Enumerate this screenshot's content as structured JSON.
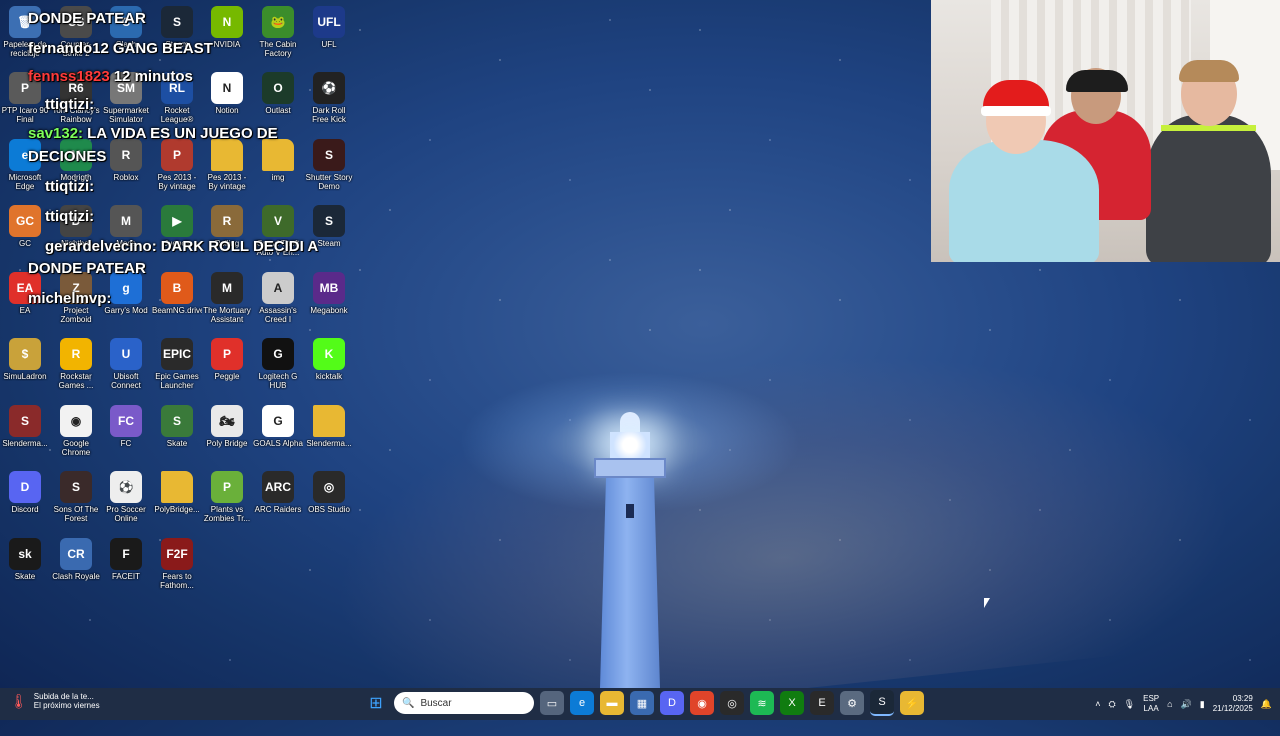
{
  "desktop": {
    "icons": [
      {
        "label": "Papelera de reciclaje",
        "color": "#3c6fb3",
        "glyph": "🗑",
        "icon": "recycle-bin"
      },
      {
        "label": "Counter-Strike 2",
        "color": "#4a4a4a",
        "glyph": "CS",
        "icon": "counter-strike"
      },
      {
        "label": "Clash",
        "color": "#2b6ab0",
        "glyph": "C",
        "icon": "game"
      },
      {
        "label": "Steam",
        "color": "#1b2838",
        "glyph": "S",
        "icon": "steam"
      },
      {
        "label": "NVIDIA",
        "color": "#76b900",
        "glyph": "N",
        "icon": "nvidia"
      },
      {
        "label": "The Cabin Factory",
        "color": "#3b8d2b",
        "glyph": "🐸",
        "icon": "frog"
      },
      {
        "label": "UFL",
        "color": "#1d3a8a",
        "glyph": "UFL",
        "icon": "ufl"
      },
      {
        "label": "PTP Icaro 90 Final",
        "color": "#5a5a5a",
        "glyph": "P",
        "icon": "app"
      },
      {
        "label": "Tom Clancy's Rainbow Six...",
        "color": "#333333",
        "glyph": "R6",
        "icon": "game"
      },
      {
        "label": "Supermarket Simulator",
        "color": "#777777",
        "glyph": "SM",
        "icon": "game"
      },
      {
        "label": "Rocket League®",
        "color": "#1d4fa3",
        "glyph": "RL",
        "icon": "rocket"
      },
      {
        "label": "Notion",
        "color": "#ffffff",
        "glyph": "N",
        "icon": "notion"
      },
      {
        "label": "Outlast",
        "color": "#1c3b2a",
        "glyph": "O",
        "icon": "game"
      },
      {
        "label": "Dark Roll Free Kick Challe...",
        "color": "#222222",
        "glyph": "⚽",
        "icon": "ball"
      },
      {
        "label": "Microsoft Edge",
        "color": "#0c7bd6",
        "glyph": "e",
        "icon": "edge"
      },
      {
        "label": "Modrigth",
        "color": "#1f8a4c",
        "glyph": "M",
        "icon": "app"
      },
      {
        "label": "Roblox",
        "color": "#555555",
        "glyph": "R",
        "icon": "roblox"
      },
      {
        "label": "Pes 2013 - By vintage Ga...",
        "color": "#b03a2e",
        "glyph": "P",
        "icon": "winrar"
      },
      {
        "label": "Pes 2013 - By vintage Ga...",
        "color": "#e8b833",
        "glyph": "",
        "icon": "folder"
      },
      {
        "label": "img",
        "color": "#e8b833",
        "glyph": "",
        "icon": "folder"
      },
      {
        "label": "Shutter Story Demo",
        "color": "#3a1a1a",
        "glyph": "S",
        "icon": "game"
      },
      {
        "label": "GC",
        "color": "#e0742c",
        "glyph": "GC",
        "icon": "app"
      },
      {
        "label": "Nightbot",
        "color": "#444444",
        "glyph": "D",
        "icon": "app"
      },
      {
        "label": "Mods",
        "color": "#555555",
        "glyph": "M",
        "icon": "app"
      },
      {
        "label": "Juegos",
        "color": "#2a7a3b",
        "glyph": "▶",
        "icon": "game"
      },
      {
        "label": "Rolling",
        "color": "#8a6a3a",
        "glyph": "R",
        "icon": "game"
      },
      {
        "label": "Grand Theft Auto V En...",
        "color": "#3e6a2a",
        "glyph": "V",
        "icon": "gta"
      },
      {
        "label": "Steam",
        "color": "#1b2838",
        "glyph": "S",
        "icon": "steam"
      },
      {
        "label": "EA",
        "color": "#e0302a",
        "glyph": "EA",
        "icon": "ea"
      },
      {
        "label": "Project Zomboid",
        "color": "#7a5a3a",
        "glyph": "Z",
        "icon": "game"
      },
      {
        "label": "Garry's Mod",
        "color": "#1e6fd6",
        "glyph": "g",
        "icon": "gmod"
      },
      {
        "label": "BeamNG.drive",
        "color": "#e05a1a",
        "glyph": "B",
        "icon": "app"
      },
      {
        "label": "The Mortuary Assistant",
        "color": "#2a2a2a",
        "glyph": "M",
        "icon": "game"
      },
      {
        "label": "Assassin's Creed I",
        "color": "#cccccc",
        "glyph": "A",
        "icon": "game"
      },
      {
        "label": "Megabonk",
        "color": "#5a2a8a",
        "glyph": "MB",
        "icon": "game"
      },
      {
        "label": "SimuLadron",
        "color": "#c9a23a",
        "glyph": "$",
        "icon": "game"
      },
      {
        "label": "Rockstar Games ...",
        "color": "#f2b400",
        "glyph": "R",
        "icon": "rockstar"
      },
      {
        "label": "Ubisoft Connect",
        "color": "#2a62c9",
        "glyph": "U",
        "icon": "ubisoft"
      },
      {
        "label": "Epic Games Launcher",
        "color": "#2a2a2a",
        "glyph": "EPIC",
        "icon": "epic"
      },
      {
        "label": "Peggle",
        "color": "#e0302a",
        "glyph": "P",
        "icon": "game"
      },
      {
        "label": "Logitech G HUB",
        "color": "#111111",
        "glyph": "G",
        "icon": "logitech"
      },
      {
        "label": "kicktalk",
        "color": "#53fc18",
        "glyph": "K",
        "icon": "kick"
      },
      {
        "label": "Slenderma...",
        "color": "#8a2a2a",
        "glyph": "S",
        "icon": "winrar"
      },
      {
        "label": "Google Chrome",
        "color": "#f2f2f2",
        "glyph": "◉",
        "icon": "chrome"
      },
      {
        "label": "FC",
        "color": "#7a5ac9",
        "glyph": "FC",
        "icon": "game"
      },
      {
        "label": "Skate",
        "color": "#3a7a3a",
        "glyph": "S",
        "icon": "game"
      },
      {
        "label": "Poly Bridge",
        "color": "#e9e9e9",
        "glyph": "🏍",
        "icon": "game"
      },
      {
        "label": "GOALS Alpha",
        "color": "#ffffff",
        "glyph": "G",
        "icon": "game"
      },
      {
        "label": "Slenderma...",
        "color": "#e8b833",
        "glyph": "",
        "icon": "folder"
      },
      {
        "label": "Discord",
        "color": "#5865f2",
        "glyph": "D",
        "icon": "discord"
      },
      {
        "label": "Sons Of The Forest",
        "color": "#3a2a2a",
        "glyph": "S",
        "icon": "game"
      },
      {
        "label": "Pro Soccer Online",
        "color": "#eeeeee",
        "glyph": "⚽",
        "icon": "ball"
      },
      {
        "label": "PolyBridge...",
        "color": "#e8b833",
        "glyph": "",
        "icon": "folder"
      },
      {
        "label": "Plants vs Zombies Tr...",
        "color": "#6ab03a",
        "glyph": "P",
        "icon": "game"
      },
      {
        "label": "ARC Raiders",
        "color": "#2a2a2a",
        "glyph": "ARC",
        "icon": "game"
      },
      {
        "label": "OBS Studio",
        "color": "#2a2a2a",
        "glyph": "◎",
        "icon": "obs"
      },
      {
        "label": "Skate",
        "color": "#1a1a1a",
        "glyph": "sk",
        "icon": "game"
      },
      {
        "label": "Clash Royale",
        "color": "#3a6ab0",
        "glyph": "CR",
        "icon": "game"
      },
      {
        "label": "FACEIT",
        "color": "#1a1a1a",
        "glyph": "F",
        "icon": "faceit"
      },
      {
        "label": "Fears to Fathom...",
        "color": "#8a1a1a",
        "glyph": "F2F",
        "icon": "game"
      }
    ]
  },
  "chat": [
    {
      "user": "",
      "text": "DONDE PATEAR"
    },
    {
      "user": "fernando12",
      "text": "GANG BEAST"
    },
    {
      "user": "fennss1823",
      "text": "12 minutos"
    },
    {
      "user": "ttiqtizi:",
      "text": ""
    },
    {
      "user": "sav132:",
      "text": "LA VIDA ES UN JUEGO DE"
    },
    {
      "user": "",
      "text": "DECIONES"
    },
    {
      "user": "ttiqtizi:",
      "text": ""
    },
    {
      "user": "ttiqtizi:",
      "text": ""
    },
    {
      "user": "gerardelvecino:",
      "text": "DARK ROLL DECIDI A"
    },
    {
      "user": "",
      "text": "DONDE PATEAR"
    },
    {
      "user": "michelmvp:",
      "text": ""
    }
  ],
  "webcam": {
    "label": "webcam-feed"
  },
  "taskbar": {
    "weather_line1": "Subida de la te...",
    "weather_line2": "El próximo viernes",
    "search_placeholder": "Buscar",
    "apps": [
      "task-view",
      "edge",
      "file-explorer",
      "store",
      "discord",
      "chrome",
      "obs",
      "spotify",
      "xbox",
      "epic",
      "settings",
      "steam",
      "pinned-app"
    ],
    "lang_top": "ESP",
    "lang_bottom": "LAA",
    "time": "03:29",
    "date": "21/12/2025"
  },
  "colors": {
    "taskbar": "#1f2d45",
    "accent": "#3ea3ff"
  }
}
